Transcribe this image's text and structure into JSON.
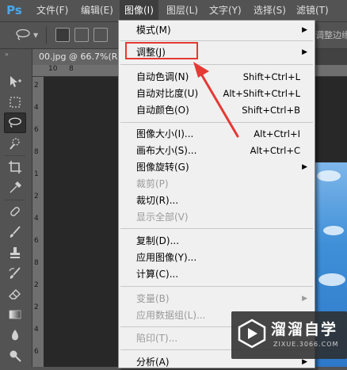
{
  "app": {
    "logo_text": "Ps"
  },
  "menubar": {
    "items": [
      {
        "label": "文件(F)"
      },
      {
        "label": "编辑(E)"
      },
      {
        "label": "图像(I)"
      },
      {
        "label": "图层(L)"
      },
      {
        "label": "文字(Y)"
      },
      {
        "label": "选择(S)"
      },
      {
        "label": "滤镜(T)"
      }
    ],
    "active_index": 2
  },
  "options_bar": {
    "tool_icon": "lasso-icon",
    "right_text": "调整边缘"
  },
  "document": {
    "tab_title": "00.jpg @ 66.7%(R",
    "ruler_top_labels": [
      "10",
      "8"
    ],
    "ruler_left_labels": [
      "2",
      "4",
      "6",
      "8",
      "1",
      "2",
      "4",
      "6",
      "8",
      "2",
      "2",
      "4",
      "6"
    ]
  },
  "toolbox": {
    "tools": [
      "move-icon",
      "marquee-icon",
      "lasso-icon",
      "quick-select-icon",
      "crop-icon",
      "eyedropper-icon",
      "healing-brush-icon",
      "brush-icon",
      "clone-stamp-icon",
      "history-brush-icon",
      "eraser-icon",
      "gradient-icon",
      "blur-icon",
      "dodge-icon"
    ],
    "selected": "lasso-icon"
  },
  "image_menu": {
    "items": [
      {
        "label": "模式(M)",
        "shortcut": "",
        "submenu": true,
        "disabled": false
      },
      {
        "label": "调整(J)",
        "shortcut": "",
        "submenu": true,
        "disabled": false
      },
      {
        "label": "自动色调(N)",
        "shortcut": "Shift+Ctrl+L",
        "submenu": false,
        "disabled": false
      },
      {
        "label": "自动对比度(U)",
        "shortcut": "Alt+Shift+Ctrl+L",
        "submenu": false,
        "disabled": false
      },
      {
        "label": "自动颜色(O)",
        "shortcut": "Shift+Ctrl+B",
        "submenu": false,
        "disabled": false
      },
      {
        "label": "图像大小(I)...",
        "shortcut": "Alt+Ctrl+I",
        "submenu": false,
        "disabled": false
      },
      {
        "label": "画布大小(S)...",
        "shortcut": "Alt+Ctrl+C",
        "submenu": false,
        "disabled": false
      },
      {
        "label": "图像旋转(G)",
        "shortcut": "",
        "submenu": true,
        "disabled": false
      },
      {
        "label": "裁剪(P)",
        "shortcut": "",
        "submenu": false,
        "disabled": true
      },
      {
        "label": "裁切(R)...",
        "shortcut": "",
        "submenu": false,
        "disabled": false
      },
      {
        "label": "显示全部(V)",
        "shortcut": "",
        "submenu": false,
        "disabled": true
      },
      {
        "label": "复制(D)...",
        "shortcut": "",
        "submenu": false,
        "disabled": false
      },
      {
        "label": "应用图像(Y)...",
        "shortcut": "",
        "submenu": false,
        "disabled": false
      },
      {
        "label": "计算(C)...",
        "shortcut": "",
        "submenu": false,
        "disabled": false
      },
      {
        "label": "变量(B)",
        "shortcut": "",
        "submenu": true,
        "disabled": true
      },
      {
        "label": "应用数据组(L)...",
        "shortcut": "",
        "submenu": false,
        "disabled": true
      },
      {
        "label": "陷印(T)...",
        "shortcut": "",
        "submenu": false,
        "disabled": true
      },
      {
        "label": "分析(A)",
        "shortcut": "",
        "submenu": true,
        "disabled": false
      }
    ],
    "highlighted_label": "调整(J)",
    "highlight_color": "#e53935"
  },
  "watermark": {
    "title": "溜溜自学",
    "subtitle": "ZIXUE.3066.COM"
  }
}
